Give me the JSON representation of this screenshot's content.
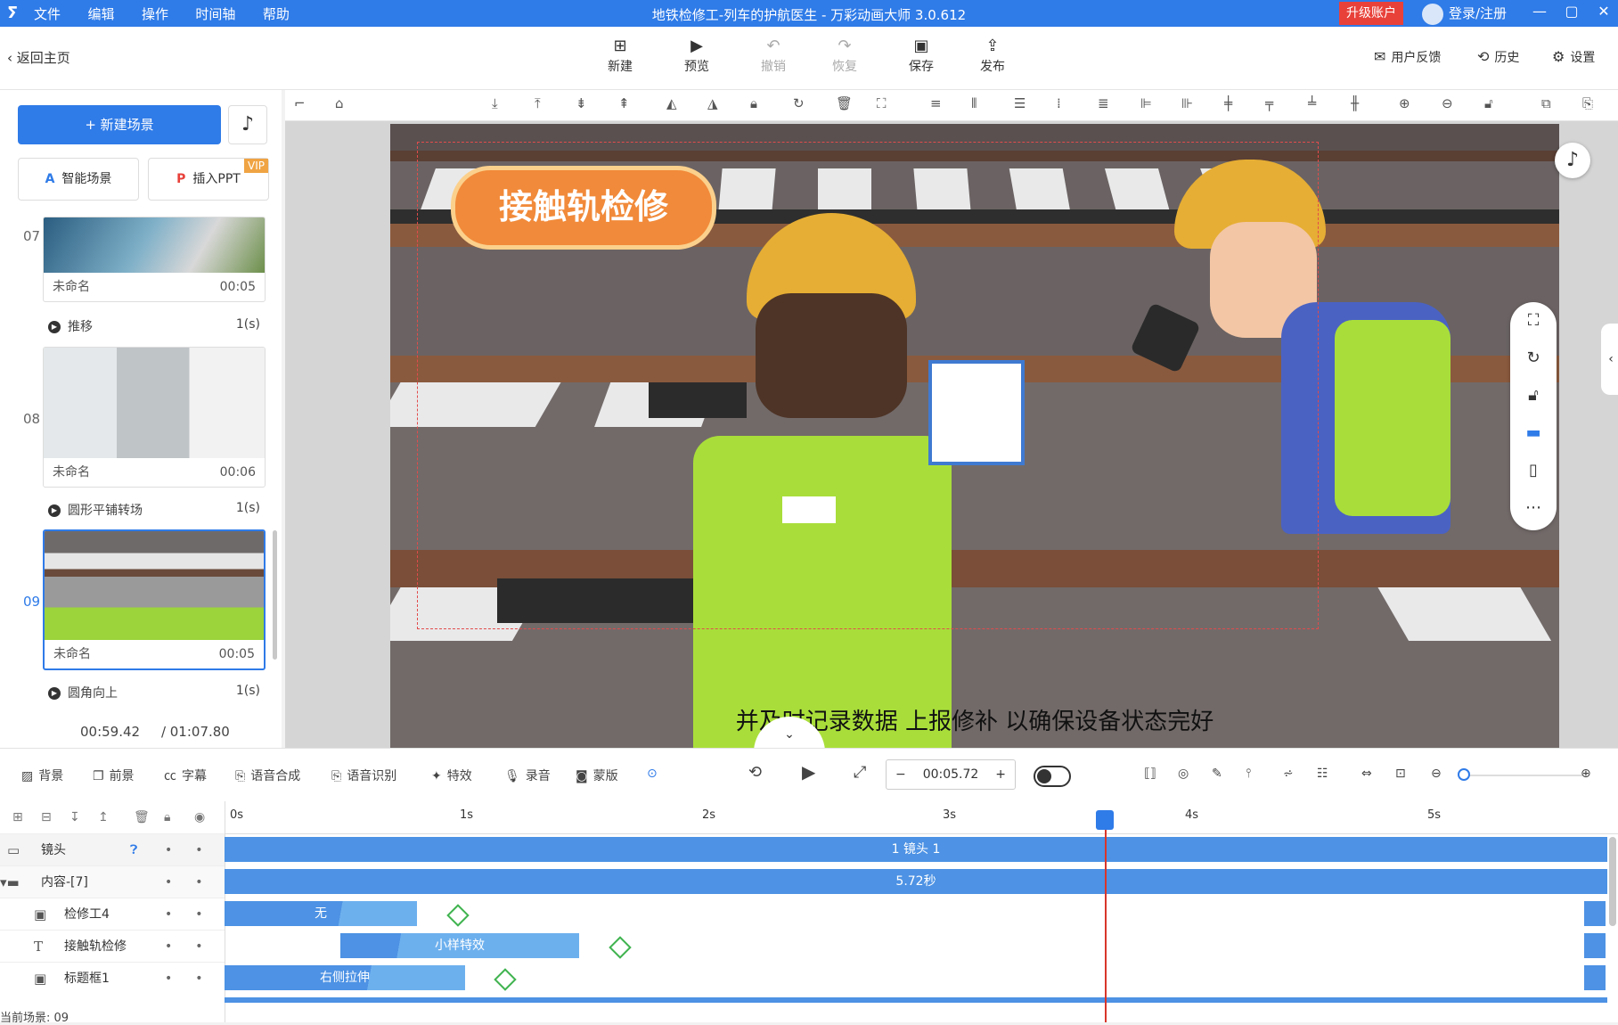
{
  "titlebar": {
    "logo": "ⵢ",
    "menu": [
      "文件",
      "编辑",
      "操作",
      "时间轴",
      "帮助"
    ],
    "title": "地铁检修工-列车的护航医生 - 万彩动画大师 3.0.612",
    "upgrade": "升级账户",
    "login": "登录/注册",
    "min": "—",
    "max": "▢",
    "close": "✕"
  },
  "toolbar": {
    "back": "返回主页",
    "new": "新建",
    "preview": "预览",
    "undo": "撤销",
    "redo": "恢复",
    "save": "保存",
    "publish": "发布",
    "feedback": "用户反馈",
    "history": "历史",
    "settings": "设置"
  },
  "left": {
    "new_scene": "+ 新建场景",
    "smart_scene": "智能场景",
    "insert_ppt": "插入PPT",
    "vip": "VIP",
    "scenes": [
      {
        "num": "07",
        "name": "未命名",
        "duration": "00:05",
        "transition": "推移",
        "trans_time": "1(s)"
      },
      {
        "num": "08",
        "name": "未命名",
        "duration": "00:06",
        "transition": "圆形平铺转场",
        "trans_time": "1(s)"
      },
      {
        "num": "09",
        "name": "未命名",
        "duration": "00:05",
        "transition": "圆角向上",
        "trans_time": "1(s)"
      }
    ],
    "time_current": "00:59.42",
    "time_total": "/ 01:07.80"
  },
  "stage": {
    "title": "接触轨检修",
    "subtitle": "并及时记录数据 上报修补 以确保设备状态完好"
  },
  "bottom": {
    "bg": "背景",
    "fg": "前景",
    "caption": "字幕",
    "tts": "语音合成",
    "asr": "语音识别",
    "effects": "特效",
    "record": "录音",
    "mask": "蒙版",
    "timecode": "00:05.72",
    "minus": "−",
    "plus": "+"
  },
  "timeline": {
    "ticks": [
      "0s",
      "1s",
      "2s",
      "3s",
      "4s",
      "5s"
    ],
    "tracks": [
      {
        "icon": "camera-icon",
        "name": "镜头",
        "bar": "1 镜头 1"
      },
      {
        "icon": "folder-icon",
        "name": "内容-[7]",
        "bar": "5.72秒"
      },
      {
        "icon": "image-icon",
        "name": "检修工4",
        "bar": "无"
      },
      {
        "icon": "text-icon",
        "name": "接触轨检修",
        "bar": "小样特效"
      },
      {
        "icon": "image-icon",
        "name": "标题框1",
        "bar": "右侧拉伸"
      }
    ],
    "current_scene": "当前场景: 09"
  },
  "colors": {
    "primary": "#2f7be8",
    "bar": "#4d92e4",
    "accent": "#f18a3a",
    "danger": "#e8413a"
  }
}
